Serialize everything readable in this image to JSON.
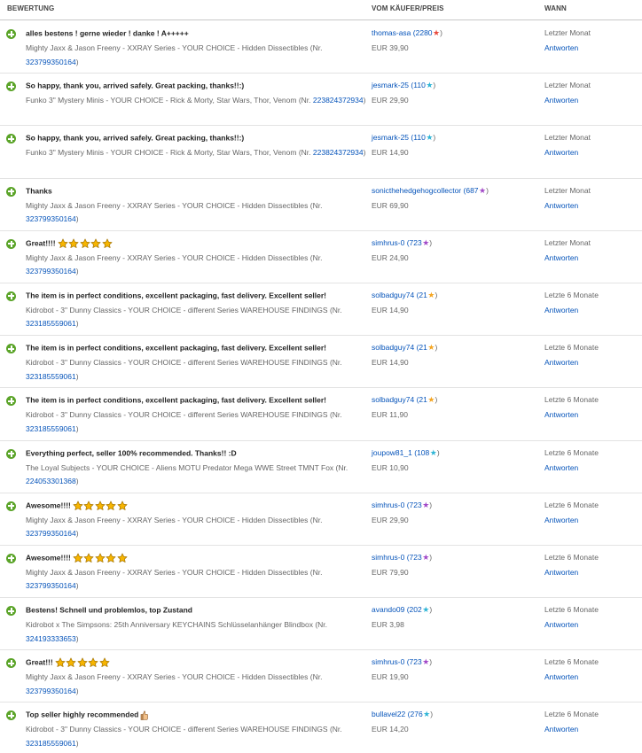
{
  "header": {
    "col_feedback": "BEWERTUNG",
    "col_buyer": "VOM KÄUFER/PREIS",
    "col_when": "WANN"
  },
  "colors": {
    "positive_icon": "#5ba429",
    "link": "#0654ba",
    "star_red": "#e8483c",
    "star_turquoise": "#2fb5d6",
    "star_purple": "#a249c8",
    "star_yellow": "#f5a623",
    "gold_star": "#f7b500"
  },
  "rows": [
    {
      "comment": "alles bestens ! gerne wieder ! danke ! A+++++",
      "gold_stars": 0,
      "emoji": false,
      "item": "Mighty Jaxx & Jason Freeny - XXRAY Series - YOUR CHOICE - Hidden Dissectibles (Nr. ",
      "item_nr": "323799350164",
      "item_end": ")",
      "buyer": "thomas-asa",
      "score": "(2280",
      "score_end": ")",
      "star_icon": "red-star",
      "price": "EUR 39,90",
      "when": "Letzter Monat",
      "reply": "Antworten"
    },
    {
      "comment": "So happy, thank you, arrived safely. Great packing, thanks!!:)",
      "gold_stars": 0,
      "emoji": false,
      "item": "Funko 3\" Mystery Minis - YOUR CHOICE - Rick & Morty, Star Wars, Thor, Venom (Nr. ",
      "item_nr": "223824372934",
      "item_end": ")",
      "buyer": "jesmark-25",
      "score": "(110",
      "score_end": ")",
      "star_icon": "turquoise-star",
      "price": "EUR 29,90",
      "when": "Letzter Monat",
      "reply": "Antworten"
    },
    {
      "comment": "So happy, thank you, arrived safely. Great packing, thanks!!:)",
      "gold_stars": 0,
      "emoji": false,
      "item": "Funko 3\" Mystery Minis - YOUR CHOICE - Rick & Morty, Star Wars, Thor, Venom (Nr. ",
      "item_nr": "223824372934",
      "item_end": ")",
      "buyer": "jesmark-25",
      "score": "(110",
      "score_end": ")",
      "star_icon": "turquoise-star",
      "price": "EUR 14,90",
      "when": "Letzter Monat",
      "reply": "Antworten"
    },
    {
      "comment": "Thanks",
      "gold_stars": 0,
      "emoji": false,
      "item": "Mighty Jaxx & Jason Freeny - XXRAY Series - YOUR CHOICE - Hidden Dissectibles (Nr. ",
      "item_nr": "323799350164",
      "item_end": ")",
      "buyer": "sonicthehedgehogcollector",
      "score": "(687",
      "score_end": ")",
      "star_icon": "purple-star",
      "price": "EUR 69,90",
      "when": "Letzter Monat",
      "reply": "Antworten"
    },
    {
      "comment": "Great!!!!",
      "gold_stars": 5,
      "emoji": false,
      "item": "Mighty Jaxx & Jason Freeny - XXRAY Series - YOUR CHOICE - Hidden Dissectibles (Nr. ",
      "item_nr": "323799350164",
      "item_end": ")",
      "buyer": "simhrus-0",
      "score": "(723",
      "score_end": ")",
      "star_icon": "purple-star",
      "price": "EUR 24,90",
      "when": "Letzter Monat",
      "reply": "Antworten"
    },
    {
      "comment": "The item is in perfect conditions, excellent packaging, fast delivery. Excellent seller!",
      "gold_stars": 0,
      "emoji": false,
      "item": "Kidrobot - 3\" Dunny Classics - YOUR CHOICE - different Series WAREHOUSE FINDINGS (Nr. ",
      "item_nr": "323185559061",
      "item_end": ")",
      "buyer": "solbadguy74",
      "score": "(21",
      "score_end": ")",
      "star_icon": "yellow-star",
      "price": "EUR 14,90",
      "when": "Letzte 6 Monate",
      "reply": "Antworten"
    },
    {
      "comment": "The item is in perfect conditions, excellent packaging, fast delivery. Excellent seller!",
      "gold_stars": 0,
      "emoji": false,
      "item": "Kidrobot - 3\" Dunny Classics - YOUR CHOICE - different Series WAREHOUSE FINDINGS (Nr. ",
      "item_nr": "323185559061",
      "item_end": ")",
      "buyer": "solbadguy74",
      "score": "(21",
      "score_end": ")",
      "star_icon": "yellow-star",
      "price": "EUR 14,90",
      "when": "Letzte 6 Monate",
      "reply": "Antworten"
    },
    {
      "comment": "The item is in perfect conditions, excellent packaging, fast delivery. Excellent seller!",
      "gold_stars": 0,
      "emoji": false,
      "item": "Kidrobot - 3\" Dunny Classics - YOUR CHOICE - different Series WAREHOUSE FINDINGS (Nr. ",
      "item_nr": "323185559061",
      "item_end": ")",
      "buyer": "solbadguy74",
      "score": "(21",
      "score_end": ")",
      "star_icon": "yellow-star",
      "price": "EUR 11,90",
      "when": "Letzte 6 Monate",
      "reply": "Antworten"
    },
    {
      "comment": "Everything perfect, seller 100% recommended. Thanks!! :D",
      "gold_stars": 0,
      "emoji": false,
      "item": "The Loyal Subjects - YOUR CHOICE - Aliens MOTU Predator Mega WWE Street TMNT Fox (Nr. ",
      "item_nr": "224053301368",
      "item_end": ")",
      "buyer": "joupow81_1",
      "score": "(108",
      "score_end": ")",
      "star_icon": "turquoise-star",
      "price": "EUR 10,90",
      "when": "Letzte 6 Monate",
      "reply": "Antworten"
    },
    {
      "comment": "Awesome!!!!",
      "gold_stars": 5,
      "emoji": false,
      "item": "Mighty Jaxx & Jason Freeny - XXRAY Series - YOUR CHOICE - Hidden Dissectibles (Nr. ",
      "item_nr": "323799350164",
      "item_end": ")",
      "buyer": "simhrus-0",
      "score": "(723",
      "score_end": ")",
      "star_icon": "purple-star",
      "price": "EUR 29,90",
      "when": "Letzte 6 Monate",
      "reply": "Antworten"
    },
    {
      "comment": "Awesome!!!!",
      "gold_stars": 5,
      "emoji": false,
      "item": "Mighty Jaxx & Jason Freeny - XXRAY Series - YOUR CHOICE - Hidden Dissectibles (Nr. ",
      "item_nr": "323799350164",
      "item_end": ")",
      "buyer": "simhrus-0",
      "score": "(723",
      "score_end": ")",
      "star_icon": "purple-star",
      "price": "EUR 79,90",
      "when": "Letzte 6 Monate",
      "reply": "Antworten"
    },
    {
      "comment": "Bestens! Schnell und problemlos, top Zustand",
      "gold_stars": 0,
      "emoji": false,
      "item": "Kidrobot x The Simpsons: 25th Anniversary KEYCHAINS Schlüsselanhänger Blindbox (Nr. ",
      "item_nr": "324193333653",
      "item_end": ")",
      "buyer": "avando09",
      "score": "(202",
      "score_end": ")",
      "star_icon": "turquoise-star",
      "price": "EUR 3,98",
      "when": "Letzte 6 Monate",
      "reply": "Antworten"
    },
    {
      "comment": "Great!!!",
      "gold_stars": 5,
      "emoji": false,
      "item": "Mighty Jaxx & Jason Freeny - XXRAY Series - YOUR CHOICE - Hidden Dissectibles (Nr. ",
      "item_nr": "323799350164",
      "item_end": ")",
      "buyer": "simhrus-0",
      "score": "(723",
      "score_end": ")",
      "star_icon": "purple-star",
      "price": "EUR 19,90",
      "when": "Letzte 6 Monate",
      "reply": "Antworten"
    },
    {
      "comment": "Top seller highly recommended",
      "gold_stars": 0,
      "emoji": true,
      "item": "Kidrobot - 3\" Dunny Classics - YOUR CHOICE - different Series WAREHOUSE FINDINGS (Nr. ",
      "item_nr": "323185559061",
      "item_end": ")",
      "buyer": "bullavel22",
      "score": "(276",
      "score_end": ")",
      "star_icon": "turquoise-star",
      "price": "EUR 14,20",
      "when": "Letzte 6 Monate",
      "reply": "Antworten"
    }
  ]
}
